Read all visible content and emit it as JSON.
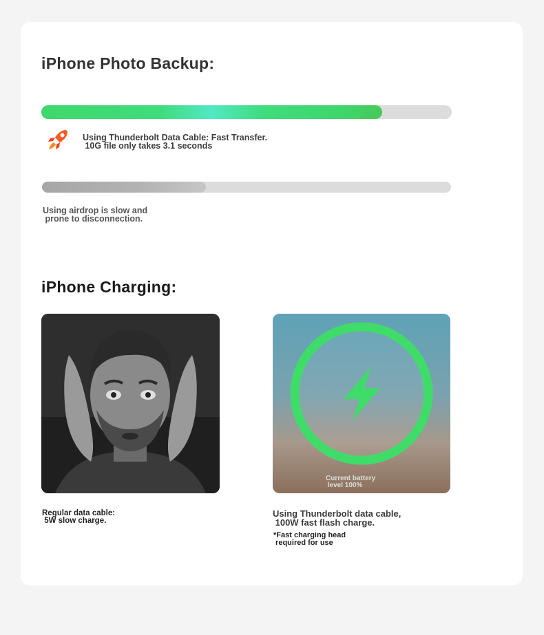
{
  "backup": {
    "title": "iPhone Photo Backup:",
    "fast": {
      "progress": 0.83,
      "icon": "rocket-icon",
      "text": "Using Thunderbolt Data Cable: Fast Transfer.\n 10G file only takes 3.1 seconds"
    },
    "slow": {
      "progress": 0.4,
      "text": "Using airdrop is slow and\n prone to disconnection."
    }
  },
  "charging": {
    "title": "iPhone Charging:",
    "regular": {
      "image": "stressed-man-photo",
      "caption": "Regular data cable:\n 5W slow charge."
    },
    "fast": {
      "image": "lightning-charge-icon",
      "battery_label": "Current battery\n level 100%",
      "battery_level": 1.0,
      "caption": "Using Thunderbolt data cable,\n 100W fast flash charge.",
      "note": "*Fast charging head\n required for use"
    }
  },
  "colors": {
    "accent_green": "#3fdc6a",
    "rocket_orange": "#ff5a1f"
  }
}
